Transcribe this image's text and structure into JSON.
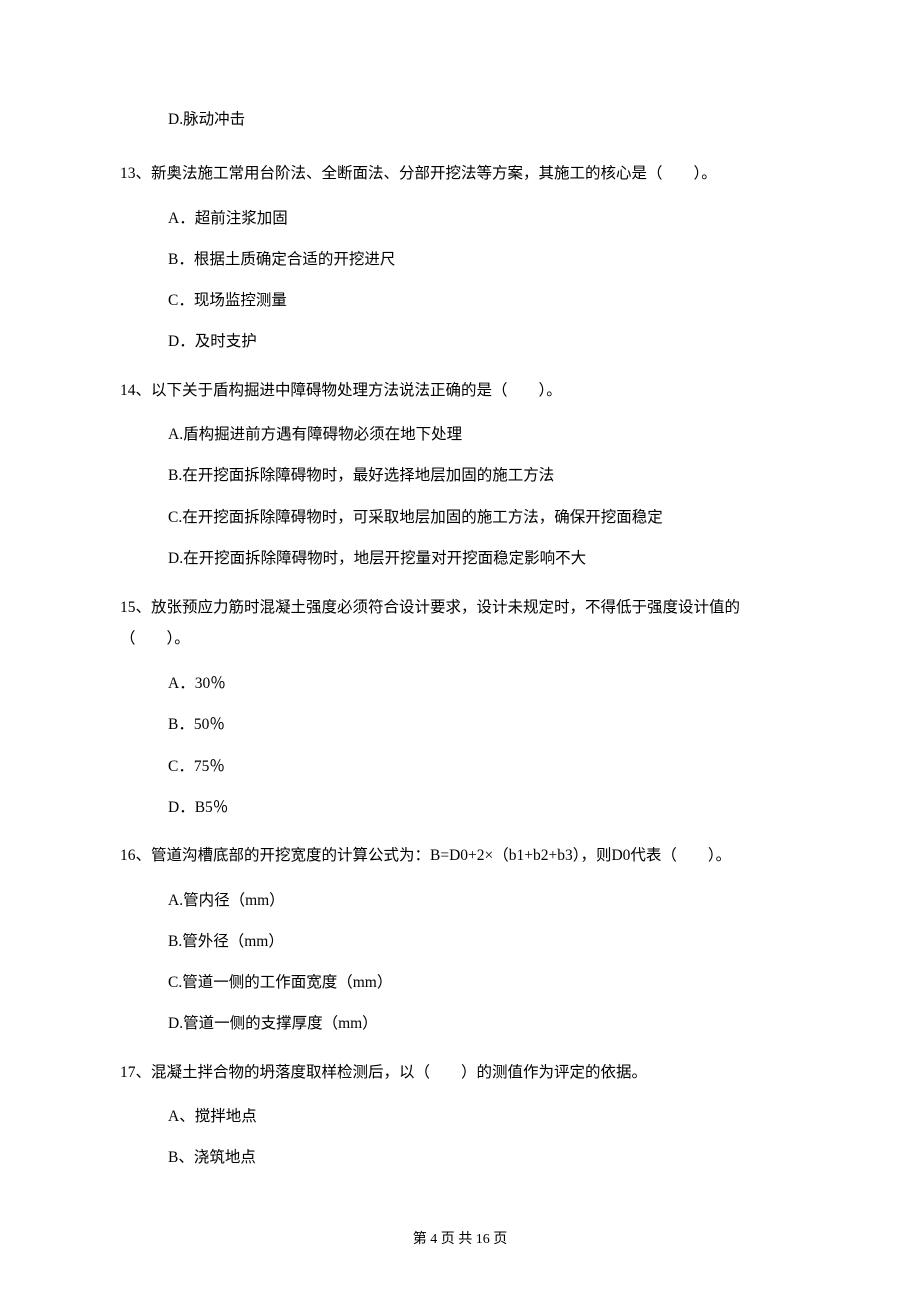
{
  "orphan_option": "D.脉动冲击",
  "questions": [
    {
      "num": "13",
      "text": "13、新奥法施工常用台阶法、全断面法、分部开挖法等方案，其施工的核心是（　　）。",
      "options": [
        "A．超前注浆加固",
        "B．根据土质确定合适的开挖进尺",
        "C．现场监控测量",
        "D．及时支护"
      ]
    },
    {
      "num": "14",
      "text": "14、以下关于盾构掘进中障碍物处理方法说法正确的是（　　）。",
      "options": [
        "A.盾构掘进前方遇有障碍物必须在地下处理",
        "B.在开挖面拆除障碍物时，最好选择地层加固的施工方法",
        "C.在开挖面拆除障碍物时，可采取地层加固的施工方法，确保开挖面稳定",
        "D.在开挖面拆除障碍物时，地层开挖量对开挖面稳定影响不大"
      ]
    },
    {
      "num": "15",
      "text": "15、放张预应力筋时混凝土强度必须符合设计要求，设计未规定时，不得低于强度设计值的（　　）。",
      "options": [
        "A．30％",
        "B．50％",
        "C．75％",
        "D．B5％"
      ]
    },
    {
      "num": "16",
      "text": "16、管道沟槽底部的开挖宽度的计算公式为：B=D0+2×（b1+b2+b3），则D0代表（　　）。",
      "options": [
        "A.管内径（mm）",
        "B.管外径（mm）",
        "C.管道一侧的工作面宽度（mm）",
        "D.管道一侧的支撑厚度（mm）"
      ]
    },
    {
      "num": "17",
      "text": "17、混凝土拌合物的坍落度取样检测后，以（　　）的测值作为评定的依据。",
      "options": [
        "A、搅拌地点",
        "B、浇筑地点"
      ]
    }
  ],
  "footer": "第 4 页 共 16 页"
}
